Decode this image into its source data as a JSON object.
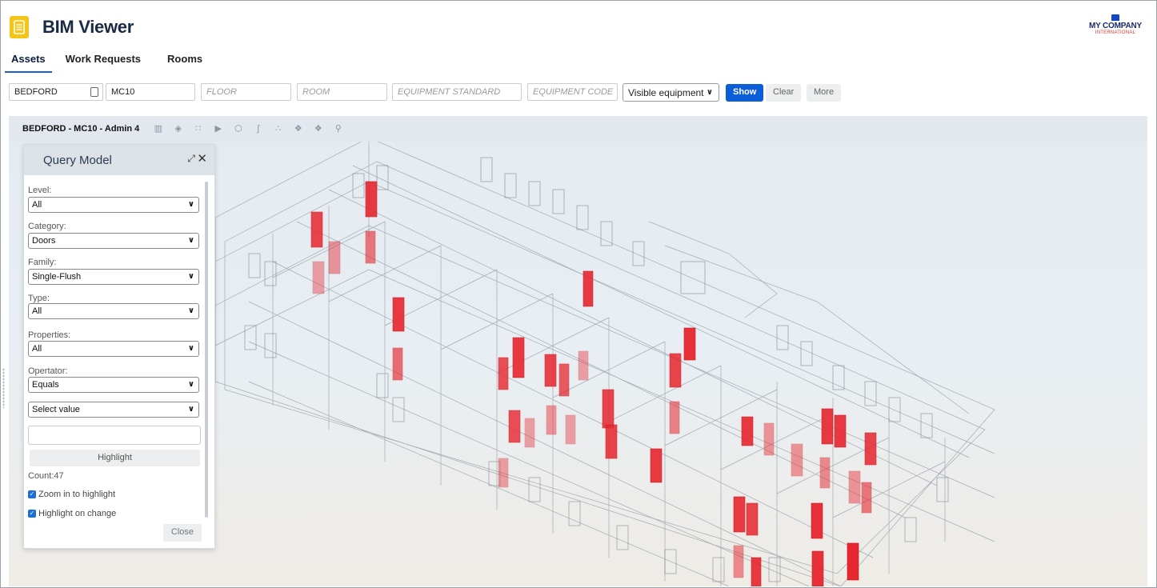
{
  "app": {
    "title": "BIM Viewer"
  },
  "company": {
    "name": "MY COMPANY",
    "sub": "INTERNATIONAL"
  },
  "tabs": [
    {
      "label": "Assets",
      "active": true
    },
    {
      "label": "Work Requests",
      "active": false
    },
    {
      "label": "Rooms",
      "active": false
    }
  ],
  "filters": {
    "site": "BEDFORD",
    "building": "MC10",
    "floor_placeholder": "FLOOR",
    "room_placeholder": "ROOM",
    "standard_placeholder": "EQUIPMENT STANDARD",
    "code_placeholder": "EQUIPMENT CODE",
    "visibility": "Visible equipment",
    "show_label": "Show",
    "clear_label": "Clear",
    "more_label": "More"
  },
  "viewer": {
    "title": "BEDFORD - MC10 - Admin 4",
    "tools": [
      "building-icon",
      "layers-icon",
      "grid-icon",
      "tag-icon",
      "cube-icon",
      "path-icon",
      "share-icon",
      "network-icon",
      "sequence-icon",
      "search-icon"
    ],
    "highlight_color": "#e8262f"
  },
  "query_panel": {
    "title": "Query Model",
    "level_label": "Level:",
    "level_value": "All",
    "category_label": "Category:",
    "category_value": "Doors",
    "family_label": "Family:",
    "family_value": "Single-Flush",
    "type_label": "Type:",
    "type_value": "All",
    "properties_label": "Properties:",
    "properties_value": "All",
    "operator_label": "Opertator:",
    "operator_value": "Equals",
    "value_select": "Select value",
    "highlight_label": "Highlight",
    "count": "Count:47",
    "zoom_label": "Zoom in to highlight",
    "zoom_checked": true,
    "change_label": "Highlight on change",
    "change_checked": true,
    "close_label": "Close"
  }
}
